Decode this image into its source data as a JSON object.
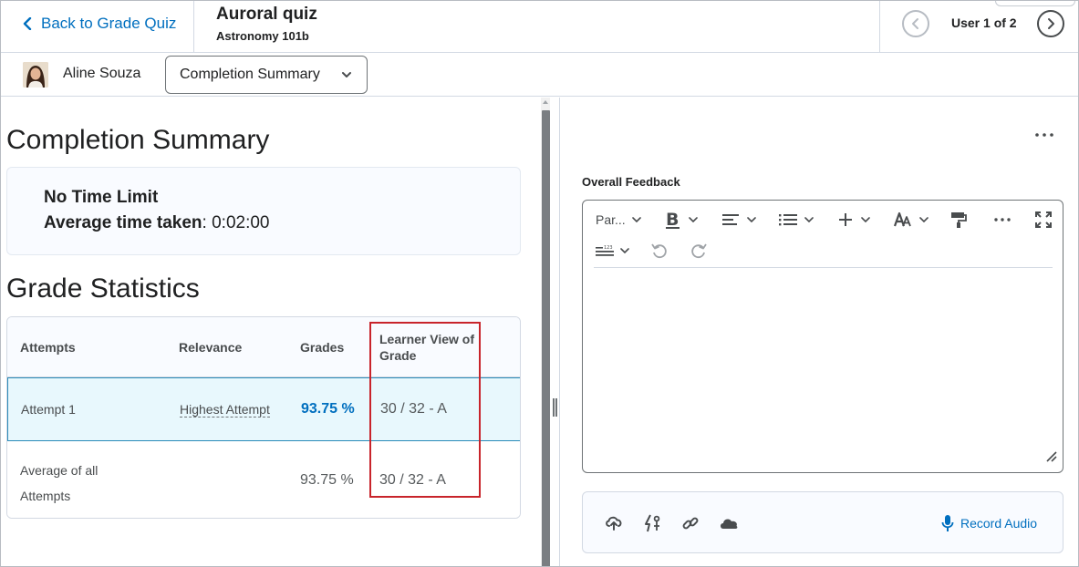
{
  "header": {
    "back_label": "Back to Grade Quiz",
    "quiz_title": "Auroral quiz",
    "course": "Astronomy 101b",
    "user_count": "User 1 of 2"
  },
  "userbar": {
    "user_name": "Aline Souza",
    "view_selected": "Completion Summary"
  },
  "completion": {
    "heading": "Completion Summary",
    "time_limit": "No Time Limit",
    "avg_label": "Average time taken",
    "avg_value": ": 0:02:00"
  },
  "grade_stats": {
    "heading": "Grade Statistics",
    "columns": [
      "Attempts",
      "Relevance",
      "Grades",
      "Learner View of Grade"
    ],
    "rows": [
      {
        "attempt": "Attempt 1",
        "relevance": "Highest Attempt",
        "grade": "93.75 %",
        "learner_view": "30 / 32 - A"
      },
      {
        "attempt": "Average of all Attempts",
        "relevance": "",
        "grade": "93.75 %",
        "learner_view": "30 / 32 - A"
      }
    ]
  },
  "feedback": {
    "label": "Overall Feedback",
    "paragraph_style": "Par...",
    "record_audio": "Record Audio"
  },
  "icons": {
    "back": "chevron-left-icon",
    "prev": "chevron-left-circle-icon",
    "next": "chevron-right-circle-icon",
    "dropdown": "chevron-down-icon",
    "more": "ellipsis-icon",
    "bold": "bold-icon",
    "align": "align-left-icon",
    "list": "bullet-list-icon",
    "insert": "plus-icon",
    "font": "font-size-icon",
    "format_painter": "paint-roller-icon",
    "fullscreen": "fullscreen-icon",
    "line_height": "line-spacing-icon",
    "undo": "undo-icon",
    "redo": "redo-icon",
    "upload": "cloud-upload-icon",
    "quicklinks": "quicklink-icon",
    "link": "link-icon",
    "onedrive": "cloud-icon",
    "mic": "microphone-icon"
  },
  "colors": {
    "link": "#006fbf",
    "selected_row": "#e8f8fd",
    "highlight": "#c8242b"
  }
}
